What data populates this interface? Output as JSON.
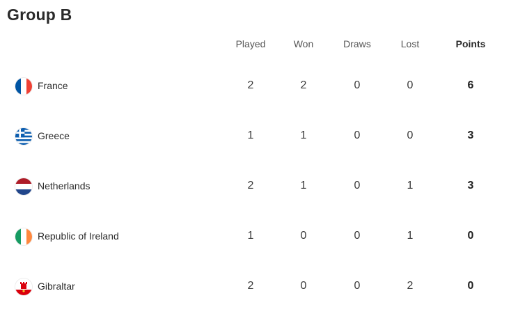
{
  "group_title": "Group B",
  "columns": {
    "played": "Played",
    "won": "Won",
    "draws": "Draws",
    "lost": "Lost",
    "points": "Points"
  },
  "rows": [
    {
      "team": "France",
      "flag": "france-flag-icon",
      "played": "2",
      "won": "2",
      "draws": "0",
      "lost": "0",
      "points": "6"
    },
    {
      "team": "Greece",
      "flag": "greece-flag-icon",
      "played": "1",
      "won": "1",
      "draws": "0",
      "lost": "0",
      "points": "3"
    },
    {
      "team": "Netherlands",
      "flag": "netherlands-flag-icon",
      "played": "2",
      "won": "1",
      "draws": "0",
      "lost": "1",
      "points": "3"
    },
    {
      "team": "Republic of Ireland",
      "flag": "ireland-flag-icon",
      "played": "1",
      "won": "0",
      "draws": "0",
      "lost": "1",
      "points": "0"
    },
    {
      "team": "Gibraltar",
      "flag": "gibraltar-flag-icon",
      "played": "2",
      "won": "0",
      "draws": "0",
      "lost": "2",
      "points": "0"
    }
  ],
  "colors": {
    "france_blue": "#0055a4",
    "france_red": "#ef4135",
    "greece_blue": "#0d5eaf",
    "netherlands_red": "#ae1c28",
    "netherlands_blue": "#21468b",
    "ireland_green": "#169b62",
    "ireland_orange": "#ff883e",
    "gibraltar_red": "#da000c"
  }
}
